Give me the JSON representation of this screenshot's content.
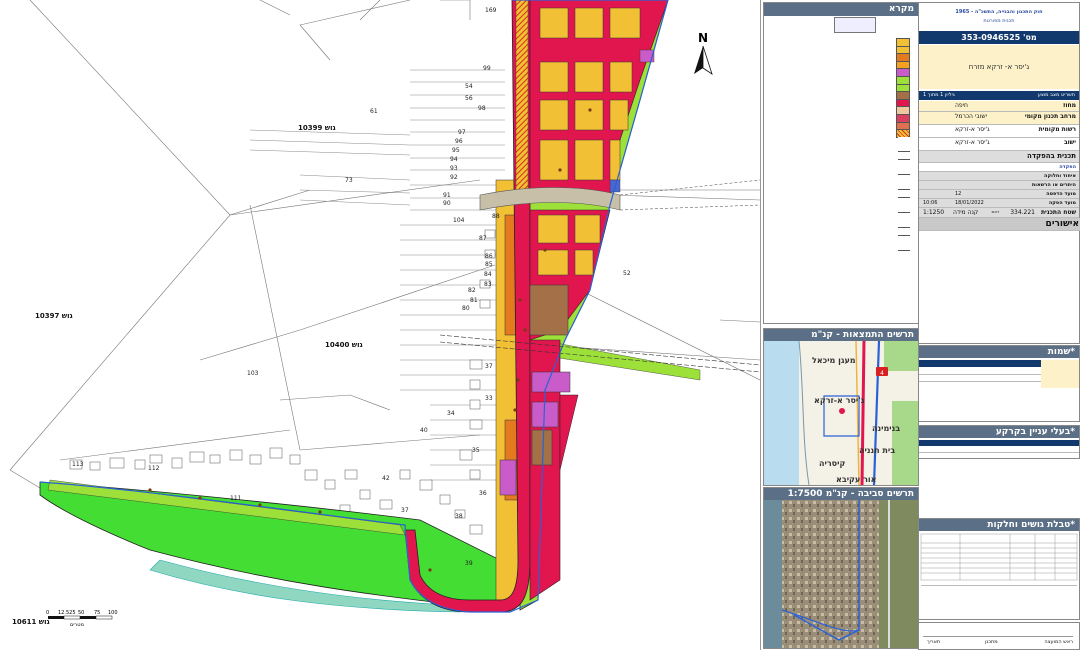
{
  "map": {
    "north_label": "N",
    "gush_labels": [
      {
        "id": "gush-10399",
        "text": "גוש 10399"
      },
      {
        "id": "gush-10397",
        "text": "גוש 10397"
      },
      {
        "id": "gush-10400",
        "text": "גוש 10400"
      },
      {
        "id": "gush-10611",
        "text": "גוש 10611"
      }
    ],
    "parcel_numbers": [
      "169",
      "99",
      "54",
      "56",
      "98",
      "61",
      "97",
      "96",
      "95",
      "94",
      "93",
      "92",
      "73",
      "91",
      "90",
      "104",
      "88",
      "87",
      "86",
      "85",
      "84",
      "83",
      "82",
      "81",
      "80",
      "103",
      "37",
      "33",
      "34",
      "40",
      "35",
      "113",
      "112",
      "111",
      "42",
      "36",
      "37b",
      "38",
      "39",
      "52"
    ],
    "scale": {
      "ticks": [
        "0",
        "12.525",
        "50",
        "75",
        "100"
      ],
      "unit": "מטרים"
    }
  },
  "legend": {
    "title": "מקרא"
  },
  "info": {
    "header_line1": "חוק התכנון והבנייה, התשכ\"ה - 1965",
    "header_line2": "תכנית מפורטת",
    "plan_number": "מס' 353-0946525",
    "plan_name": "ג'יסר א- זרקא מזרח",
    "sub_header": "תשריט מצב מוצע",
    "sheet_info": "גיליון 1 מתוך 1",
    "rows": [
      {
        "label": "מחוז",
        "value": "חיפה"
      },
      {
        "label": "מרחב תכנון מקומי",
        "value": "ישובי הכרמל"
      },
      {
        "label": "רשות מקומית",
        "value": "ג'יסר א-זרקא"
      },
      {
        "label": "ישוב",
        "value": "ג'יסר א-זרקא"
      }
    ],
    "stage_title": "תכנית בהפקדה",
    "stage_values": [
      "הפקדה",
      "איחוד וחלוקה",
      "היתרים או הרשאות",
      "מועד הדפסה",
      "מועד הפקה"
    ],
    "print_count": "12",
    "date": "18/01/2022",
    "time": "10:06",
    "area_label": "שטח התכנית",
    "area_value": "334.221",
    "area_unit": "דונם",
    "scale_label": "קנה מידה",
    "scale_value": "1:1250",
    "approvals_title": "אישורים"
  },
  "inset_national": {
    "title": "תרשים התמצאות - קנ\"מ 1:30000",
    "places": [
      "מעגן מיכאל",
      "ג'יסר א-זרקא",
      "בנימינה",
      "בית חנניה",
      "קיסריה",
      "אור עקיבא"
    ],
    "road_number": "4"
  },
  "inset_aerial": {
    "title": "תרשים סביבה - קנ\"מ 1:7500"
  },
  "box_shmaot": {
    "title": "שמות*"
  },
  "box_owners": {
    "title": "בעלי עניין בקרקע*"
  },
  "box_parcels": {
    "title": "טבלת גושים וחלקות*"
  },
  "footer": {
    "labels": [
      "ראש המועצה",
      "מתכנן",
      "תאריך"
    ]
  },
  "colors": {
    "residential": "#f2c035",
    "road": "#e2164f",
    "green": "#9ee03a",
    "green_bright": "#44dd33",
    "commercial": "#a47048",
    "public": "#c95cc8",
    "header_blue": "#12396d",
    "legend_header": "#5b6f86"
  }
}
